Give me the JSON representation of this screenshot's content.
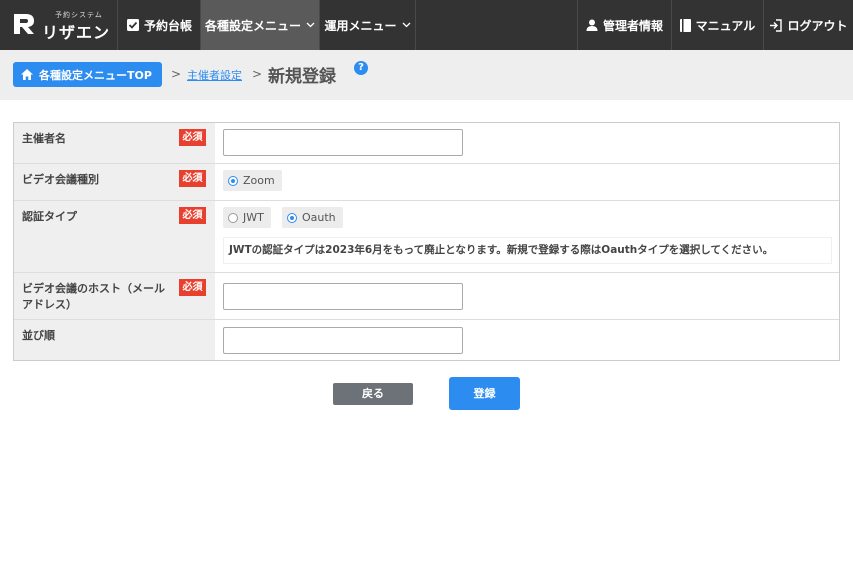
{
  "app": {
    "logo_sub": "予約システム",
    "logo_main": "リザエン"
  },
  "nav": {
    "reservation_ledger": "予約台帳",
    "settings_menu": "各種設定メニュー",
    "operation_menu": "運用メニュー",
    "admin_info": "管理者情報",
    "manual": "マニュアル",
    "logout": "ログアウト"
  },
  "breadcrumb": {
    "top_button": "各種設定メニューTOP",
    "separator": ">",
    "organizer_settings": "主催者設定",
    "page_title": "新規登録",
    "help": "?"
  },
  "form": {
    "required_label": "必須",
    "organizer_name": {
      "label": "主催者名",
      "value": ""
    },
    "video_type": {
      "label": "ビデオ会議種別",
      "options": [
        {
          "label": "Zoom",
          "selected": true
        }
      ]
    },
    "auth_type": {
      "label": "認証タイプ",
      "options": [
        {
          "label": "JWT",
          "selected": false
        },
        {
          "label": "Oauth",
          "selected": true
        }
      ],
      "notice": "JWTの認証タイプは2023年6月をもって廃止となります。新規で登録する際はOauthタイプを選択してください。"
    },
    "host_email": {
      "label": "ビデオ会議のホスト（メールアドレス）",
      "value": ""
    },
    "sort_order": {
      "label": "並び順",
      "value": ""
    }
  },
  "actions": {
    "back": "戻る",
    "submit": "登録"
  },
  "colors": {
    "header": "#333333",
    "accent": "#2d8cf0",
    "required": "#e8402e",
    "back_button": "#6c7278"
  }
}
